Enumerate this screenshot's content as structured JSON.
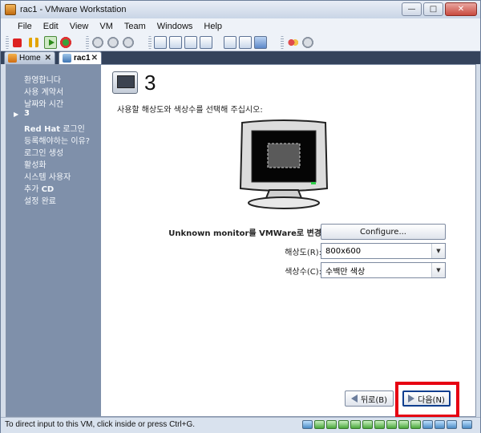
{
  "window": {
    "title": "rac1 - VMware Workstation"
  },
  "menu": [
    "File",
    "Edit",
    "View",
    "VM",
    "Team",
    "Windows",
    "Help"
  ],
  "tabs": [
    {
      "label": "Home",
      "close": "✕"
    },
    {
      "label": "rac1",
      "close": "✕"
    }
  ],
  "sidebar": {
    "items": [
      {
        "text": "환영합니다"
      },
      {
        "text": "사용 계약서"
      },
      {
        "text": "날짜와 시간"
      },
      {
        "text": "3",
        "current": true
      },
      {
        "bold": "Red Hat",
        "text": " 로그인"
      },
      {
        "text": "등록해야하는 이유?"
      },
      {
        "text": "로그인 생성"
      },
      {
        "text": "활성화"
      },
      {
        "text": "시스템 사용자"
      },
      {
        "text": "추가 ",
        "bold": "CD"
      },
      {
        "text": "설정 완료"
      }
    ]
  },
  "main": {
    "step_title": "3",
    "prompt": "사용할 해상도와 색상수를 선택해 주십시오:",
    "monitor_label": "Unknown monitor를 VMWare로 변경",
    "configure_label": "Configure...",
    "resolution_label": "해상도(R):",
    "resolution_value": "800x600",
    "color_label": "색상수(C):",
    "color_value": "수백만 색상",
    "back_label": "뒤로(B)",
    "next_label": "다음(N)"
  },
  "status": {
    "text": "To direct input to this VM, click inside or press Ctrl+G."
  },
  "colors": {
    "sidebar": "#7f90aa",
    "highlight": "#e60012",
    "tabbar": "#34435c"
  }
}
